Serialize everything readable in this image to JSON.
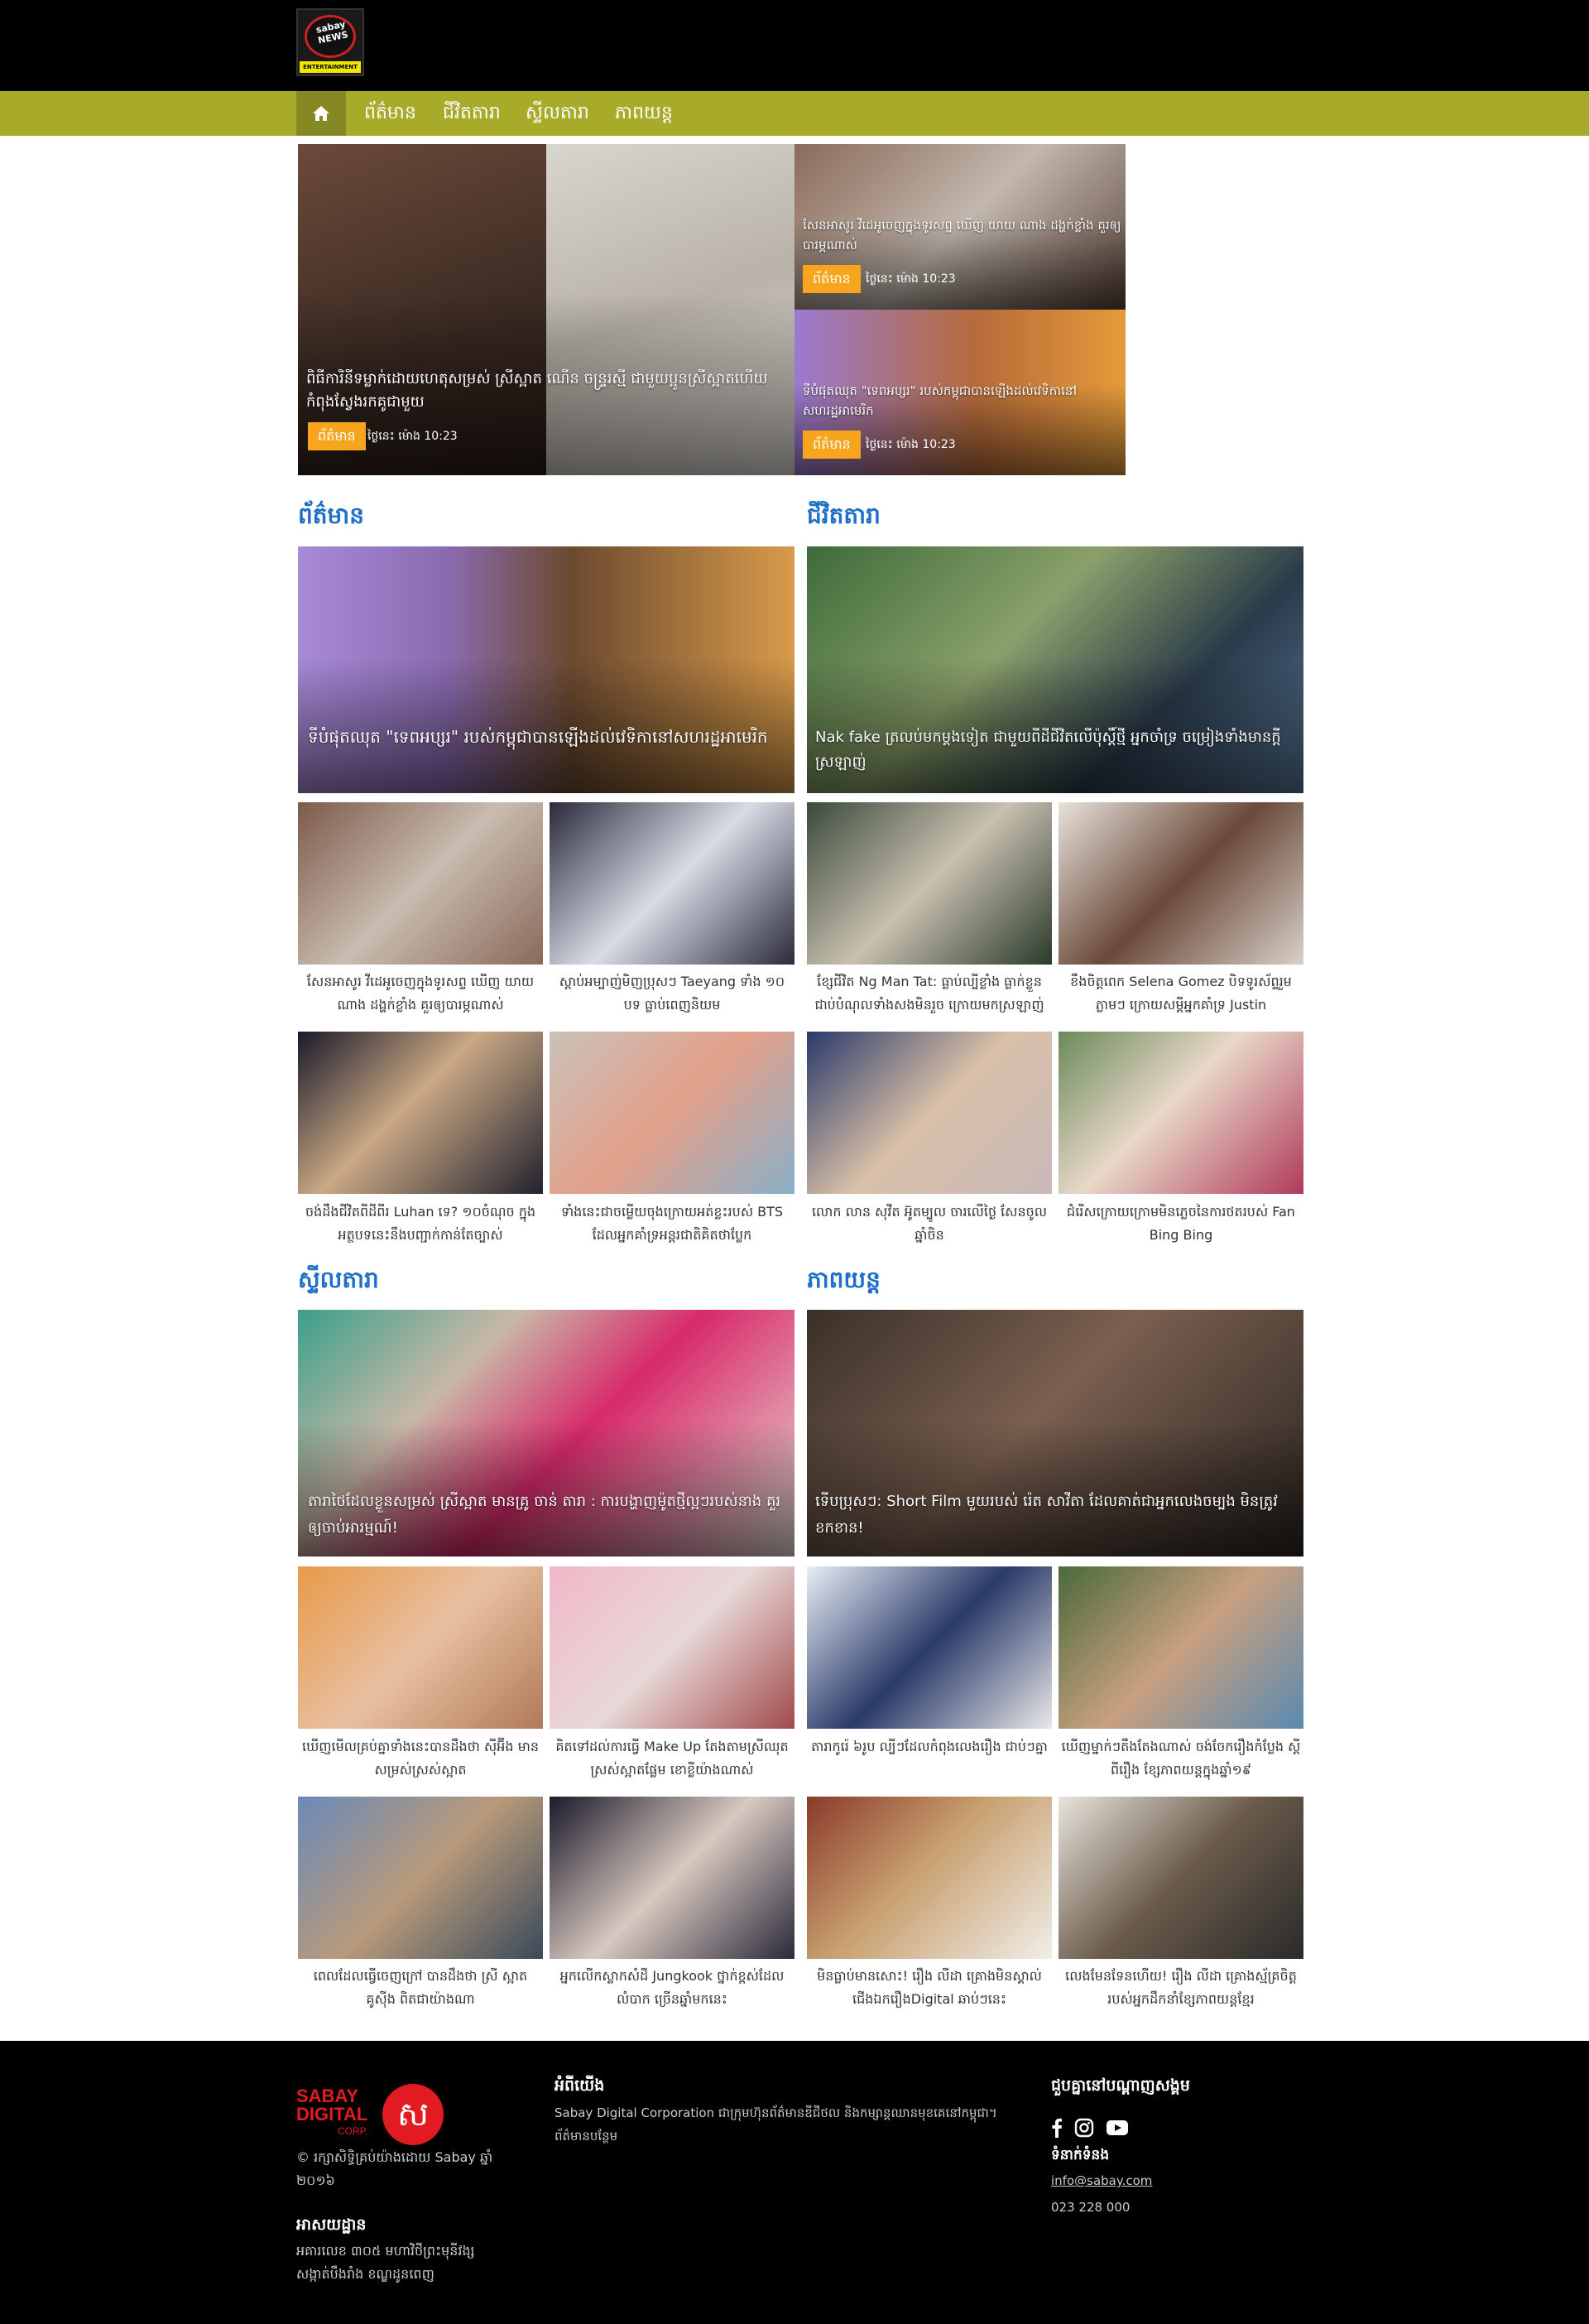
{
  "header": {
    "logo_top": "sabay",
    "logo_mid": "NEWS",
    "logo_band": "ENTERTAINMENT"
  },
  "nav": {
    "items": [
      "ព័ត៌មាន",
      "ជីវិតតារា",
      "ស្ទីលតារា",
      "ភាពយន្ត"
    ]
  },
  "hero": {
    "main": {
      "title": "ពិធីការិនីទម្លាក់ដោយហេតុសម្រស់ ស្រីស្អាត ណើន ចន្ទ្ររស្មី ជាមួយប្អូនស្រីស្អាតហើយ កំពុងស្វែងរកគូជាមួយ",
      "badge": "ព័ត៌មាន",
      "time": "ថ្ងៃនេះ ម៉ោង 10:23"
    },
    "side_top": {
      "title": "សែនអាសូរ វីដេអូចេញក្នុងទូរសព្ទ ឃើញ យាយ ណាង ដង្ហក់ខ្លាំង គួរឲ្យបារម្ភណាស់",
      "badge": "ព័ត៌មាន",
      "time": "ថ្ងៃនេះ ម៉ោង 10:23"
    },
    "side_bottom": {
      "title": "ទីបំផុតឈុត \"ទេពអប្សរ\" របស់កម្ពុជាបានឡើងដល់វេទិកានៅសហរដ្ឋអាមេរិក",
      "badge": "ព័ត៌មាន",
      "time": "ថ្ងៃនេះ ម៉ោង 10:23"
    }
  },
  "sections": [
    {
      "title": "ព័ត៌មាន",
      "feature": "ទីបំផុតឈុត \"ទេពអប្សរ\" របស់កម្ពុជាបានឡើងដល់វេទិកានៅសហរដ្ឋអាមេរិក",
      "items": [
        "សែនអាសូរ វីដេអូចេញក្នុងទូរសព្ទ ឃើញ យាយ ណាង ដង្ហក់ខ្លាំង គួរឲ្យបារម្ភណាស់",
        "ស្តាប់អម្បាញ់មិញប្រុសៗ Taeyang ទាំង ១០ បទ ធ្លាប់ពេញនិយម",
        "ចង់ដឹងជីវិតពីដីពីរ Luhan ទេ? ១០ចំណុច ក្នុងអត្ថបទនេះនឹងបញ្ជាក់កាន់តែច្បាស់",
        "ទាំងនេះជាចម្លើយចុងក្រោយអត់ខ្លះរបស់ BTS ដែលអ្នកគាំទ្រអន្តរជាតិគិតថាប្លែក"
      ]
    },
    {
      "title": "ជីវិតតារា",
      "feature": "Nak fake ត្រលប់មកម្ដងទៀត ជាមួយពីដីជីវិតលើប៉ុស្តិ៍ថ្មី អ្នកចាំទ្រ ចម្រៀងទាំងមានក្តីស្រឡាញ់",
      "items": [
        "ខ្សែជីវិត Ng Man Tat: ធ្លាប់ល្បីខ្លាំង ធ្លាក់ខ្លួន ជាប់បំណុលទាំងសងមិនរួច ក្រោយមកស្រឡាញ់",
        "ខឹងចិត្តពេក Selena Gomez បិទទូរស័ព្ទរួម ភ្លាមៗ ក្រោយសម្ដីអ្នកគាំទ្រ Justin",
        "លោក លាន សុវីត អ៊ូតម្បូល ចារលើថ្ងៃ សែនចូលឆ្នាំចិន",
        "ជំរើសក្រោយក្រោមមិនភ្លេចនៃការថតរបស់ Fan Bing Bing"
      ]
    },
    {
      "title": "ស្ទីលតារា",
      "feature": "តារាថៃដែលខ្លួនសម្រស់ ស្រីស្អាត មានគ្រូ ចាន់ តារា : ការបង្ហាញម៉ូតថ្មីល្អៗរបស់នាង គួរឲ្យចាប់អារម្មណ៍!",
      "items": [
        "ឃើញមើលគ្រប់គ្នាទាំងនេះបានដឹងថា ស៊ីអ៊ីង មានសម្រស់ស្រស់ស្អាត",
        "គិតទៅដល់ការធ្វើ Make Up តែងតាមស្រីឈុត ស្រស់ស្អាតផ្លែម ខោខ្លីយ៉ាងណាស់",
        "ពេលដែលធ្វើចេញក្រៅ បានដឹងថា ស្រី ស្អាត គូស៊ីង ពិតជាយ៉ាងណា",
        "អ្នកលើកស្លាកសំដី Jungkook ថ្នាក់ខ្ពស់ដែលលំបាក ច្រើនឆ្នាំមកនេះ"
      ]
    },
    {
      "title": "ភាពយន្ត",
      "feature": "ទើបប្រុសៗ: Short Film មួយរបស់ រ៉េត សាវីតា ដែលគាត់ជាអ្នកលេងចម្បង មិនត្រូវខកខាន!",
      "items": [
        "តារាកូរ៉េ ៦រូប ល្បីៗដែលកំពុងលេងរឿង ជាប់ៗគ្នា",
        "ឃើញម្នាក់ៗតឹងតែងណាស់ ចង់ចែករឿងកំប្លែង ស្តីពីរឿង ខ្សែភាពយន្តក្នុងឆ្នាំ១៩",
        "មិនធ្លាប់មានសោះ! រឿង លីដា គ្រោងមិនស្គាល់ ជើងឯករឿងDigital ឆាប់ៗនេះ",
        "លេងមែនទែនហើយ! រឿង លីដា គ្រោងស្ម័គ្រចិត្តរបស់អ្នកដឹកនាំខ្សែភាពយន្តខ្មែរ"
      ]
    }
  ],
  "footer": {
    "logo_line1": "SABAY",
    "logo_line2": "DIGITAL",
    "logo_line3": "CORP.",
    "logo_mark": "ស",
    "copyright": "© រក្សាសិទ្ធិគ្រប់យ៉ាងដោយ Sabay ឆ្នាំ ២០១៦",
    "address_title": "អាសយដ្ឋាន",
    "address": "អគារលេខ ៣០៥ មហាវិថីព្រះមុនីវង្ស សង្កាត់បឹងរាំង ខណ្ឌដូនពេញ",
    "about_title": "អំពីយើង",
    "about": "Sabay Digital Corporation ជាក្រុមហ៊ុនព័ត៌មានឌីជីថល និងកម្សាន្តឈានមុខគេនៅកម្ពុជា។",
    "about_more": "ព័ត៌មានបន្ថែម",
    "social_title": "ជួបគ្នានៅបណ្តាញសង្គម",
    "contact_title": "ទំនាក់ទំនង",
    "email": "info@sabay.com",
    "phone": "023 228 000"
  }
}
